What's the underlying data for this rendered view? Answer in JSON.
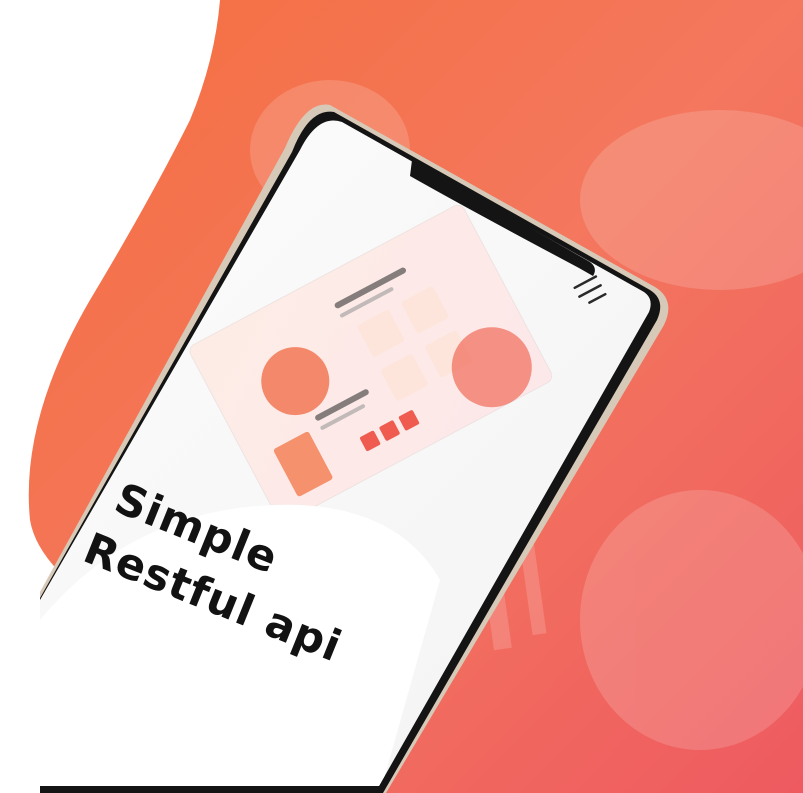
{
  "hero": {
    "headline_line1": "Simple",
    "headline_line2": "Restful api",
    "menu_icon": "hamburger-menu-icon"
  },
  "colors": {
    "gradient_start": "#f66b3c",
    "gradient_mid": "#f4765b",
    "gradient_end": "#ee5a60",
    "phone_frame": "#1b1b1b",
    "phone_screen": "#fbfbfb",
    "headline_text": "#121212"
  }
}
